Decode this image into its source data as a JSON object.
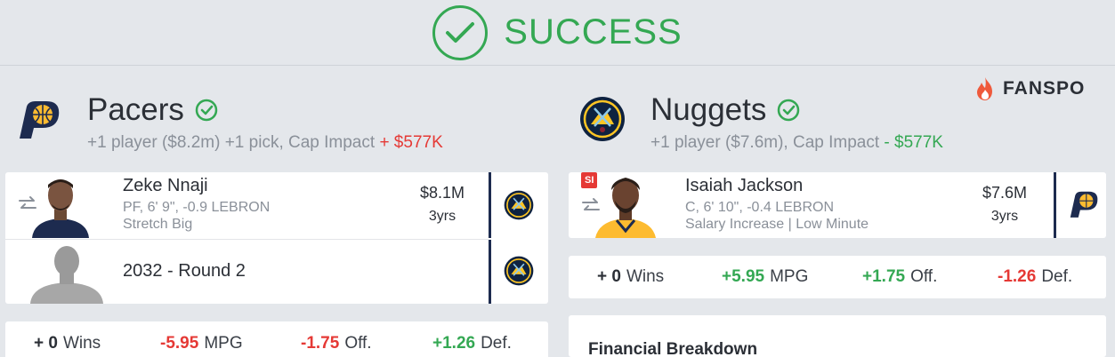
{
  "banner": {
    "title": "SUCCESS"
  },
  "brand": {
    "name": "FANSPO"
  },
  "teams": [
    {
      "name": "Pacers",
      "summary_prefix": "+1 player ($8.2m) +1 pick, Cap Impact",
      "cap_impact": "+ $577K",
      "assets": [
        {
          "type": "player",
          "name": "Zeke Nnaji",
          "details": "PF, 6' 9\", -0.9 LEBRON",
          "role": "Stretch Big",
          "salary": "$8.1M",
          "years": "3yrs",
          "destination_icon": "nuggets-logo-icon"
        },
        {
          "type": "pick",
          "name": "2032 - Round 2",
          "destination_icon": "nuggets-logo-icon"
        }
      ],
      "stats": [
        {
          "value": "+ 0",
          "label": "Wins",
          "tone": "neutral"
        },
        {
          "value": "-5.95",
          "label": "MPG",
          "tone": "red"
        },
        {
          "value": "-1.75",
          "label": "Off.",
          "tone": "red"
        },
        {
          "value": "+1.26",
          "label": "Def.",
          "tone": "green"
        }
      ]
    },
    {
      "name": "Nuggets",
      "summary_prefix": "+1 player ($7.6m), Cap Impact",
      "cap_impact": "- $577K",
      "assets": [
        {
          "type": "player",
          "badge": "SI",
          "name": "Isaiah Jackson",
          "details": "C, 6' 10\", -0.4 LEBRON",
          "role": "Salary Increase | Low Minute",
          "salary": "$7.6M",
          "years": "3yrs",
          "destination_icon": "pacers-logo-icon"
        }
      ],
      "stats": [
        {
          "value": "+ 0",
          "label": "Wins",
          "tone": "neutral"
        },
        {
          "value": "+5.95",
          "label": "MPG",
          "tone": "green"
        },
        {
          "value": "+1.75",
          "label": "Off.",
          "tone": "green"
        },
        {
          "value": "-1.26",
          "label": "Def.",
          "tone": "red"
        }
      ]
    }
  ],
  "financial": {
    "title": "Financial Breakdown"
  },
  "colors": {
    "success": "#34a853",
    "negative": "#e53935",
    "pacers_navy": "#1d2b4f",
    "pacers_gold": "#fdbb30",
    "nuggets_navy": "#0e2240",
    "nuggets_gold": "#fec524"
  }
}
